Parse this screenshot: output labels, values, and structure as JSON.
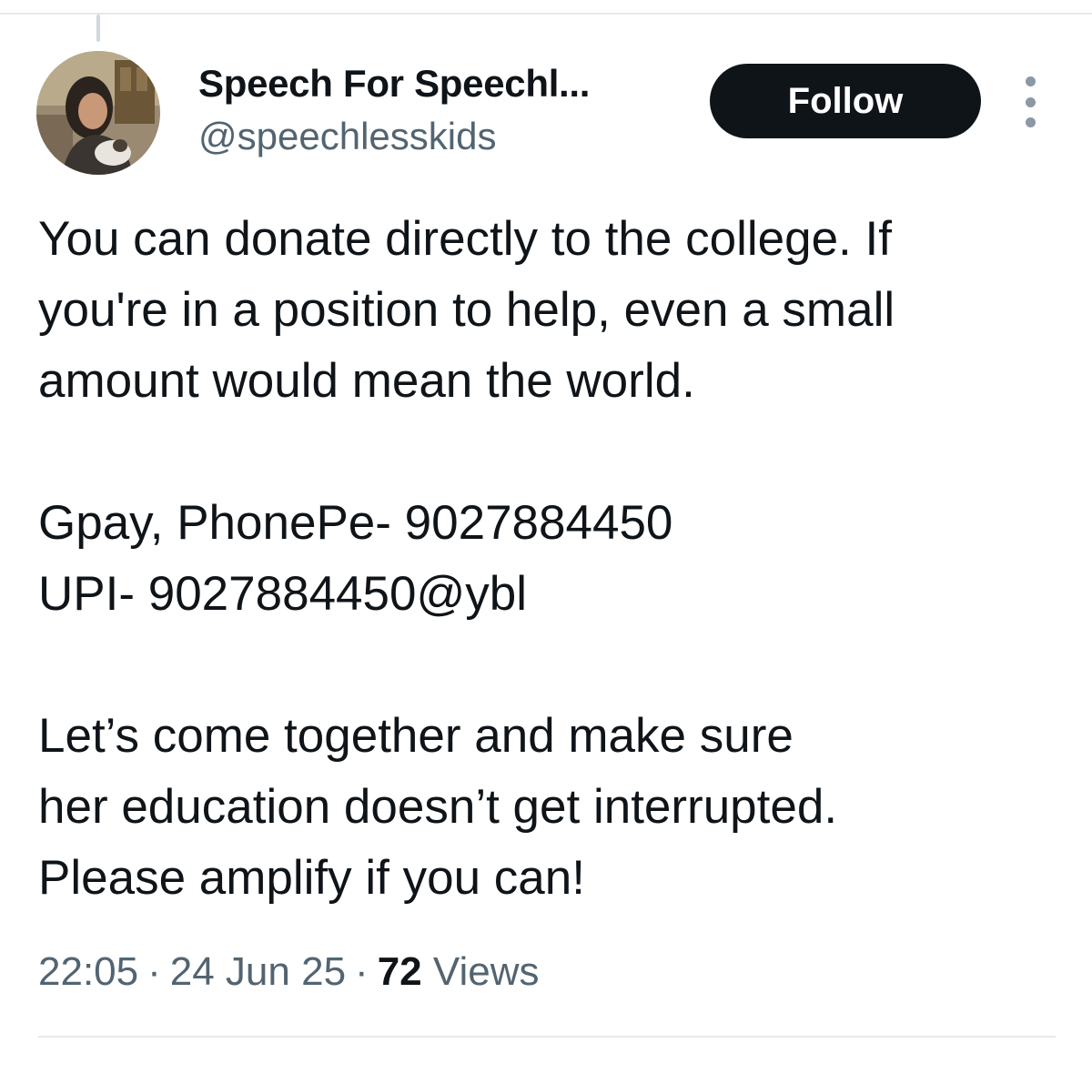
{
  "author": {
    "display_name": "Speech For Speechl...",
    "handle": "@speechlesskids"
  },
  "actions": {
    "follow_label": "Follow"
  },
  "tweet": {
    "lines": [
      "You can donate directly to the college. If",
      "you're in a position to help, even a small",
      "amount would mean the world.",
      "",
      "Gpay, PhonePe- 9027884450",
      "UPI- 9027884450@ybl",
      "",
      "Let’s come together and make sure",
      "her education doesn’t get interrupted.",
      "Please amplify if you can!"
    ]
  },
  "meta": {
    "time": "22:05",
    "separator": "·",
    "date": "24 Jun 25",
    "views_count": "72",
    "views_label": "Views"
  },
  "colors": {
    "text_primary": "#0f1419",
    "text_secondary": "#536471",
    "follow_bg": "#0f1419",
    "divider": "#e6e9eb"
  },
  "icons": {
    "more": "more-dots-vertical-icon"
  }
}
